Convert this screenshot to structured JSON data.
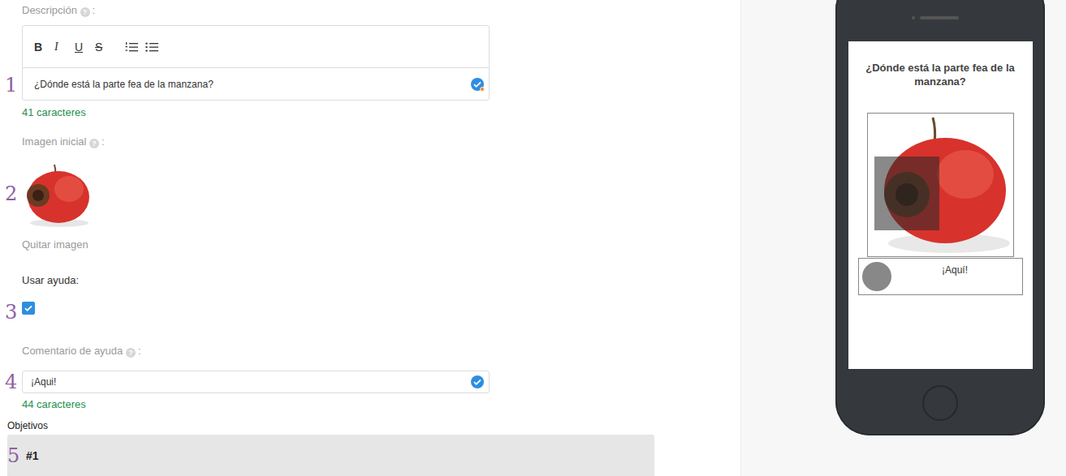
{
  "editor": {
    "description": {
      "step": "1",
      "label": "Descripción",
      "help_icon": "?",
      "colon": ":",
      "toolbar": [
        "B",
        "I",
        "U",
        "S"
      ],
      "value": "¿Dónde está la parte fea de la manzana?",
      "count": "41 caracteres"
    },
    "initial_image": {
      "step": "2",
      "label": "Imagen inicial",
      "help_icon": "?",
      "colon": ":",
      "remove_link": "Quitar imagen"
    },
    "use_help": {
      "step": "3",
      "label": "Usar ayuda",
      "colon": ":",
      "checked": true
    },
    "help_comment": {
      "step": "4",
      "label": "Comentario de ayuda",
      "help_icon": "?",
      "colon": ":",
      "value": "¡Aqui!",
      "count": "44 caracteres"
    },
    "objectives": {
      "label": "Objetivos",
      "step": "5",
      "items": [
        {
          "label": "#1"
        }
      ]
    }
  },
  "preview": {
    "title": "¿Dónde está la parte fea de la manzana?",
    "help_text": "¡Aquí!"
  }
}
